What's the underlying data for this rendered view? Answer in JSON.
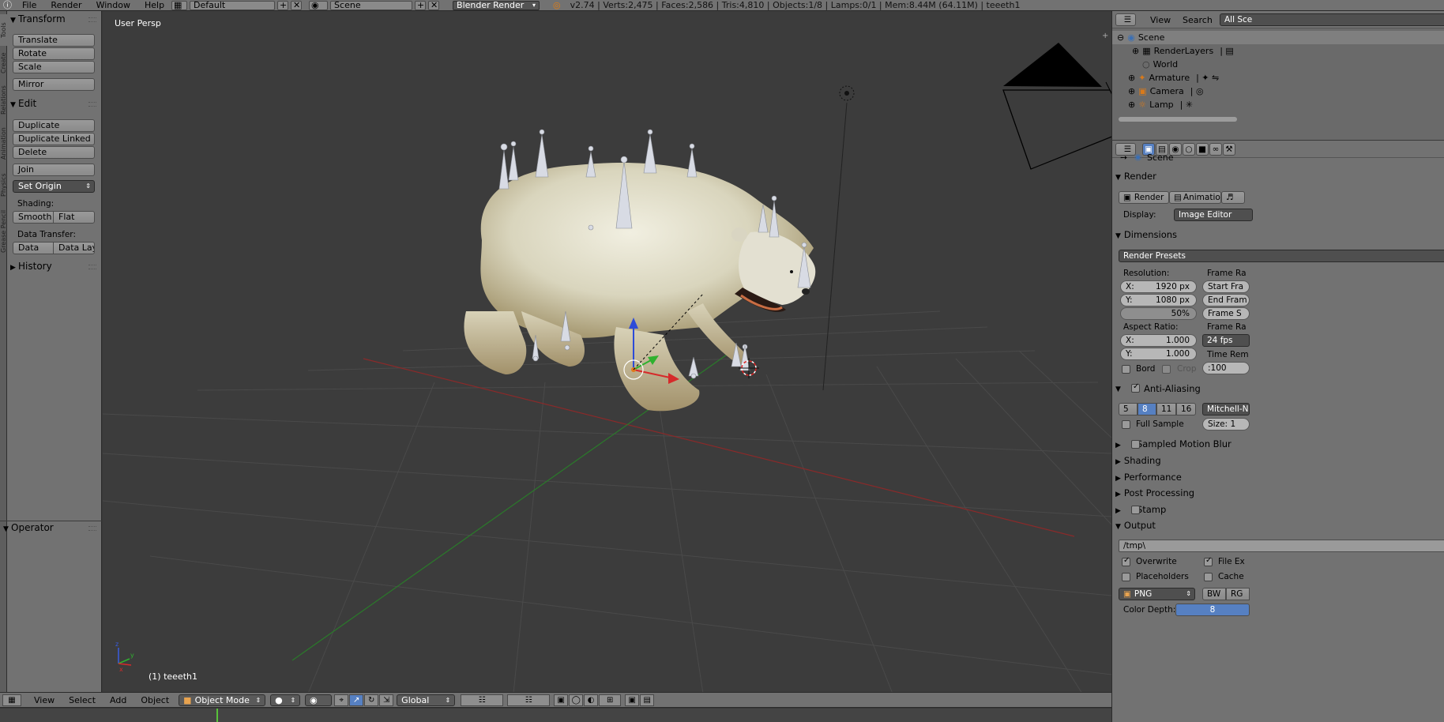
{
  "topbar": {
    "menus": [
      "File",
      "Render",
      "Window",
      "Help"
    ],
    "screen_layout": "Default",
    "scene_name": "Scene",
    "render_engine": "Blender Render",
    "stats": "v2.74 | Verts:2,475 | Faces:2,586 | Tris:4,810 | Objects:1/8 | Lamps:0/1 | Mem:8.44M (64.11M) | teeeth1"
  },
  "vtabs": [
    "Tools",
    "Create",
    "Relations",
    "Animation",
    "Physics",
    "Grease Pencil"
  ],
  "toolshelf": {
    "transform_header": "Transform",
    "translate": "Translate",
    "rotate": "Rotate",
    "scale": "Scale",
    "mirror": "Mirror",
    "edit_header": "Edit",
    "duplicate": "Duplicate",
    "duplicate_linked": "Duplicate Linked",
    "delete": "Delete",
    "join": "Join",
    "set_origin": "Set Origin",
    "shading_label": "Shading:",
    "smooth": "Smooth",
    "flat": "Flat",
    "data_transfer_label": "Data Transfer:",
    "data": "Data",
    "data_layout": "Data Layo",
    "history_header": "History",
    "operator_header": "Operator"
  },
  "viewport": {
    "view_name": "User Persp",
    "object_label": "(1) teeeth1"
  },
  "bottombar": {
    "view": "View",
    "select": "Select",
    "add": "Add",
    "object": "Object",
    "mode": "Object Mode",
    "orientation": "Global"
  },
  "outliner": {
    "view": "View",
    "search": "Search",
    "filter": "All Sce",
    "items": [
      "Scene",
      "RenderLayers",
      "World",
      "Armature",
      "Camera",
      "Lamp"
    ]
  },
  "properties": {
    "context": "Scene",
    "render_header": "Render",
    "render_btn": "Render",
    "animation_btn": "Animation",
    "display_label": "Display:",
    "display_value": "Image Editor",
    "dimensions_header": "Dimensions",
    "render_presets": "Render Presets",
    "resolution_label": "Resolution:",
    "res_x": "1920 px",
    "res_y": "1080 px",
    "res_pct": "50%",
    "x_label": "X:",
    "y_label": "Y:",
    "frame_range_label": "Frame Ra",
    "start_frame": "Start Fra",
    "end_frame": "End Fram",
    "frame_step": "Frame S",
    "aspect_label": "Aspect Ratio:",
    "aspect_x": "1.000",
    "aspect_y": "1.000",
    "frame_rate_label": "Frame Ra",
    "fps": "24 fps",
    "time_remap_label": "Time Rem",
    "time_remap_value": ":100",
    "bord": "Bord",
    "crop": "Crop",
    "aa_header": "Anti-Aliasing",
    "aa_samples": [
      "5",
      "8",
      "11",
      "16"
    ],
    "aa_filter": "Mitchell-N",
    "full_sample": "Full Sample",
    "size_label": "Size:",
    "size_value": "1",
    "motion_blur": "Sampled Motion Blur",
    "shading": "Shading",
    "performance": "Performance",
    "post_processing": "Post Processing",
    "stamp": "Stamp",
    "output_header": "Output",
    "output_path": "/tmp\\",
    "overwrite": "Overwrite",
    "file_ext": "File Ex",
    "placeholders": "Placeholders",
    "cache": "Cache",
    "format": "PNG",
    "bw": "BW",
    "rgb": "RG",
    "color_depth_label": "Color Depth:",
    "color_depth_value": "8"
  }
}
